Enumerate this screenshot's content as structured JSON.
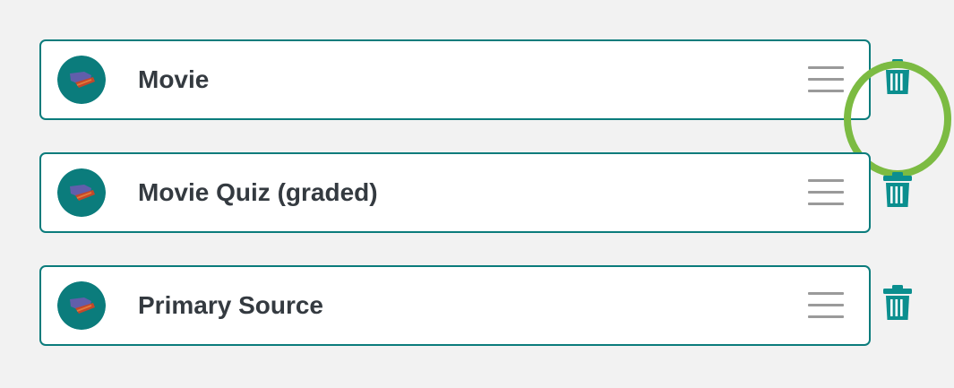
{
  "colors": {
    "background": "#f2f2f2",
    "card_border": "#0b7c7c",
    "avatar_bg": "#0b7c7c",
    "title_text": "#343a40",
    "drag_handle": "#9a9a9a",
    "delete_icon": "#0b8f8f",
    "highlight_ring": "#7cbb42"
  },
  "items": [
    {
      "title": "Movie",
      "icon": "movie-icon",
      "drag_icon": "drag-handle-icon",
      "delete_icon": "trash-icon",
      "highlighted": true
    },
    {
      "title": "Movie Quiz (graded)",
      "icon": "movie-icon",
      "drag_icon": "drag-handle-icon",
      "delete_icon": "trash-icon",
      "highlighted": false
    },
    {
      "title": "Primary Source",
      "icon": "movie-icon",
      "drag_icon": "drag-handle-icon",
      "delete_icon": "trash-icon",
      "highlighted": false
    }
  ]
}
